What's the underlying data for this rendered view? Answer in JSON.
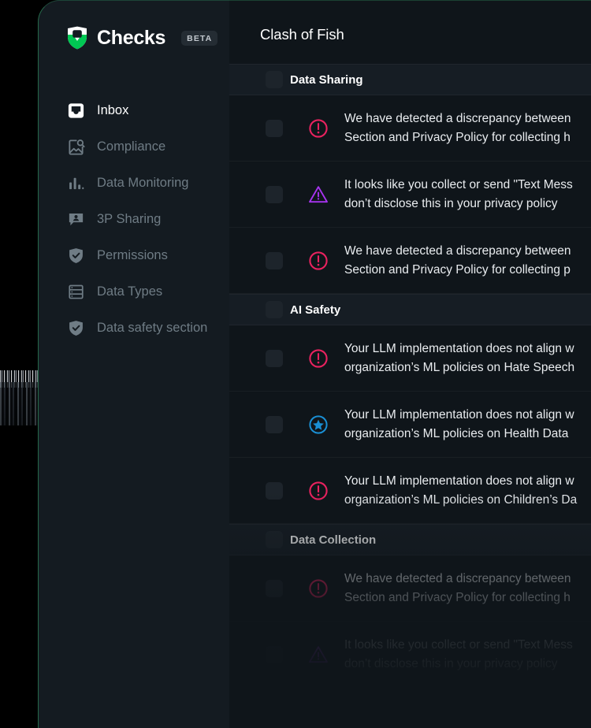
{
  "brand": {
    "name": "Checks",
    "badge": "BETA",
    "logo_icon": "shield-check-logo",
    "accent": "#00c853"
  },
  "sidebar": {
    "items": [
      {
        "label": "Inbox",
        "icon": "inbox-icon",
        "active": true
      },
      {
        "label": "Compliance",
        "icon": "image-search-icon",
        "active": false
      },
      {
        "label": "Data Monitoring",
        "icon": "bar-chart-icon",
        "active": false
      },
      {
        "label": "3P Sharing",
        "icon": "person-chat-icon",
        "active": false
      },
      {
        "label": "Permissions",
        "icon": "shield-check-icon",
        "active": false
      },
      {
        "label": "Data Types",
        "icon": "database-icon",
        "active": false
      },
      {
        "label": "Data safety section",
        "icon": "shield-check-icon",
        "active": false
      }
    ]
  },
  "main": {
    "title": "Clash of Fish",
    "groups": [
      {
        "title": "Data Sharing",
        "rows": [
          {
            "severity": "error",
            "icon": "error-circle-icon",
            "text": "We have detected a discrepancy between\nSection and Privacy Policy for collecting h"
          },
          {
            "severity": "warning",
            "icon": "warning-triangle-icon",
            "text": "It looks like you collect or send \"Text Mess\ndon’t disclose this in your privacy policy"
          },
          {
            "severity": "error",
            "icon": "error-circle-icon",
            "text": "We have detected a discrepancy between\nSection and Privacy Policy for collecting p"
          }
        ]
      },
      {
        "title": "AI Safety",
        "rows": [
          {
            "severity": "error",
            "icon": "error-circle-icon",
            "text": "Your LLM implementation does not align w\norganization’s ML policies on Hate Speech"
          },
          {
            "severity": "info",
            "icon": "star-circle-icon",
            "text": "Your LLM implementation does not align w\norganization’s ML policies on Health Data"
          },
          {
            "severity": "error",
            "icon": "error-circle-icon",
            "text": "Your LLM implementation does not align w\norganization’s ML policies on Children’s Da"
          }
        ]
      },
      {
        "title": "Data Collection",
        "rows": [
          {
            "severity": "error",
            "icon": "error-circle-icon",
            "text": "We have detected a discrepancy between\nSection and Privacy Policy for collecting h"
          },
          {
            "severity": "warning",
            "icon": "warning-triangle-icon",
            "text": "It looks like you collect or send \"Text Mess\ndon’t disclose this in your privacy policy"
          }
        ]
      }
    ]
  },
  "colors": {
    "severity_error": "#e8225f",
    "severity_warning": "#a734f0",
    "severity_info": "#1a8fd4",
    "panel_border": "#34a86c",
    "sidebar_bg": "#141b21",
    "content_bg": "#0f151a",
    "group_bg": "#161d24"
  }
}
